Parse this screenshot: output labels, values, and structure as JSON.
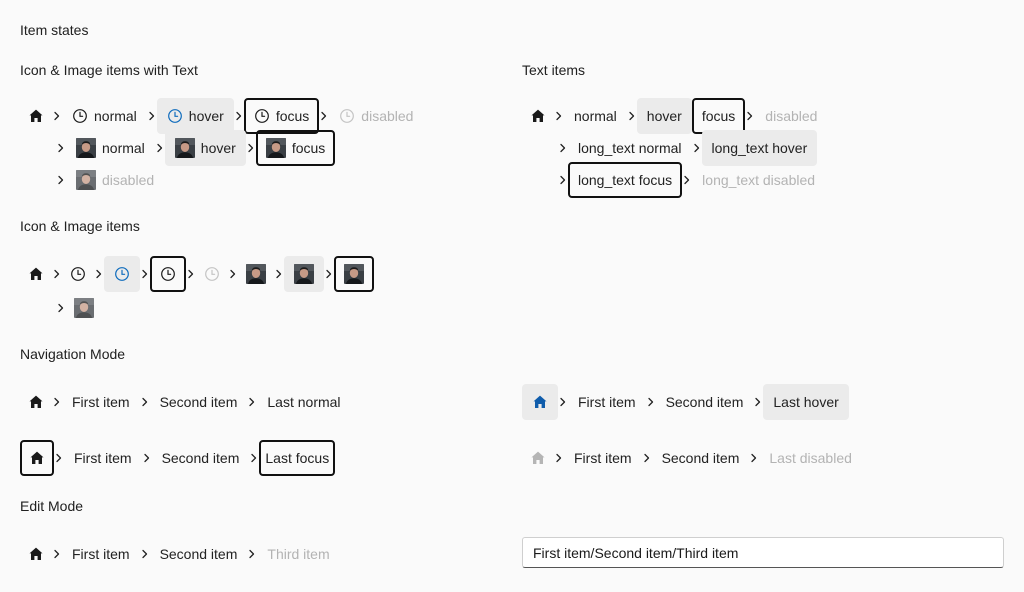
{
  "sections": {
    "item_states": "Item states",
    "icon_image_text": "Icon & Image items with Text",
    "text_items": "Text items",
    "icon_image_items": "Icon & Image items",
    "navigation_mode": "Navigation Mode",
    "edit_mode": "Edit Mode"
  },
  "icon_text": {
    "normal": "normal",
    "hover": "hover",
    "focus": "focus",
    "disabled": "disabled"
  },
  "text_items": {
    "normal": "normal",
    "hover": "hover",
    "focus": "focus",
    "disabled": "disabled",
    "long_normal": "long_text normal",
    "long_hover": "long_text hover",
    "long_focus": "long_text focus",
    "long_disabled": "long_text disabled"
  },
  "nav": {
    "first": "First item",
    "second": "Second item",
    "last_normal": "Last normal",
    "last_hover": "Last hover",
    "last_focus": "Last focus",
    "last_disabled": "Last disabled"
  },
  "edit": {
    "first": "First item",
    "second": "Second item",
    "third": "Third item",
    "path_value": "First item/Second item/Third item"
  },
  "colors": {
    "accent": "#0f6cbd",
    "focus_border": "#111111",
    "hover_bg": "#ebebeb",
    "disabled_text": "#b3b3b3"
  },
  "icons": [
    "home-icon",
    "clock-icon",
    "chevron-right-icon",
    "person-photo"
  ]
}
